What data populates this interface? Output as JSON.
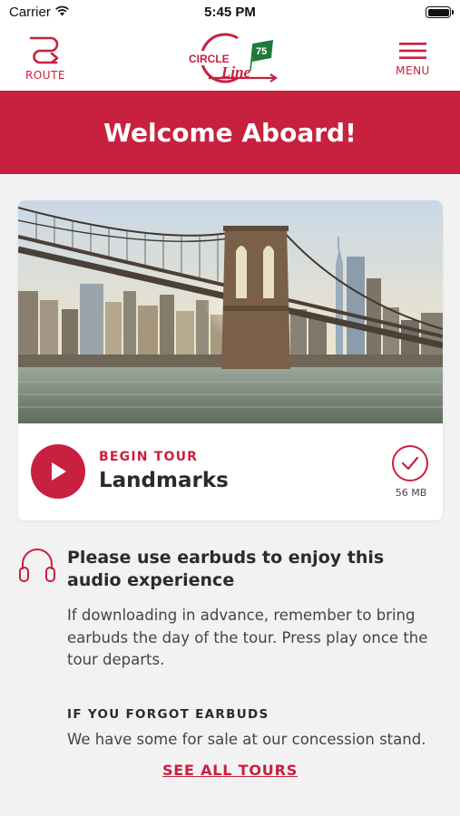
{
  "status_bar": {
    "carrier": "Carrier",
    "time": "5:45 PM"
  },
  "nav": {
    "route_label": "ROUTE",
    "menu_label": "MENU",
    "logo": {
      "line1": "CIRCLE",
      "line2": "Line",
      "badge": "75"
    }
  },
  "hero": {
    "title": "Welcome Aboard!"
  },
  "tour_card": {
    "image": "brooklyn-bridge-manhattan-skyline-photo",
    "begin_label": "BEGIN TOUR",
    "tour_name": "Landmarks",
    "download_size": "56 MB",
    "play_icon": "play-icon",
    "status_icon": "checkmark-icon"
  },
  "earbuds_notice": {
    "icon": "headphones-icon",
    "heading": "Please use earbuds to enjoy this audio experience",
    "body": "If downloading in advance, remember to bring earbuds the day of the tour. Press play once the tour departs.",
    "forgot_heading": "IF YOU FORGOT EARBUDS",
    "forgot_body": "We have some for sale at our concession stand."
  },
  "links": {
    "see_all_tours": "SEE ALL TOURS"
  },
  "colors": {
    "brand_red": "#c8203f",
    "logo_green": "#1f7a3a",
    "background": "#f2f2f2"
  }
}
